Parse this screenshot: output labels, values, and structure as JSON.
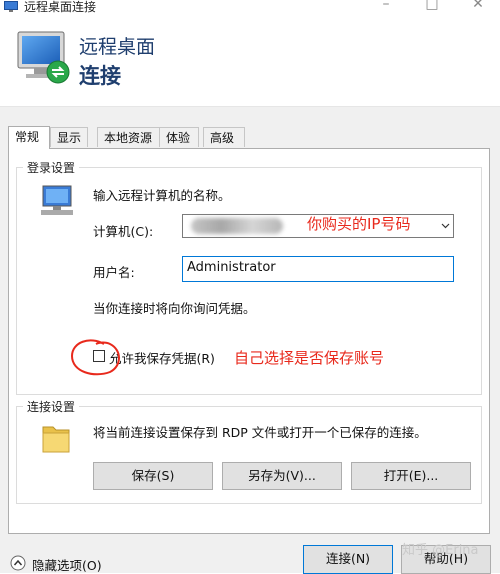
{
  "window": {
    "title": "远程桌面连接"
  },
  "header": {
    "line1": "远程桌面",
    "line2": "连接"
  },
  "tabs": [
    {
      "label": "常规",
      "active": true
    },
    {
      "label": "显示",
      "active": false
    },
    {
      "label": "本地资源",
      "active": false
    },
    {
      "label": "体验",
      "active": false
    },
    {
      "label": "高级",
      "active": false
    }
  ],
  "login": {
    "group_title": "登录设置",
    "prompt": "输入远程计算机的名称。",
    "computer_label": "计算机(C):",
    "computer_value": "",
    "username_label": "用户名:",
    "username_value": "Administrator",
    "credential_note": "当你连接时将向你询问凭据。",
    "save_credentials_label": "允许我保存凭据(R)",
    "save_credentials_checked": false
  },
  "connection": {
    "group_title": "连接设置",
    "description": "将当前连接设置保存到 RDP 文件或打开一个已保存的连接。",
    "save_button": "保存(S)",
    "save_as_button": "另存为(V)...",
    "open_button": "打开(E)..."
  },
  "footer": {
    "hide_options": "隐藏选项(O)",
    "connect_button": "连接(N)",
    "help_button": "帮助(H)"
  },
  "annotations": {
    "ip_hint": "你购买的IP号码",
    "save_hint": "自己选择是否保存账号"
  },
  "watermark": "知乎 @Erina",
  "colors": {
    "annotation": "#e8291c",
    "header_text": "#1f3e6e",
    "focus": "#0078d7"
  }
}
